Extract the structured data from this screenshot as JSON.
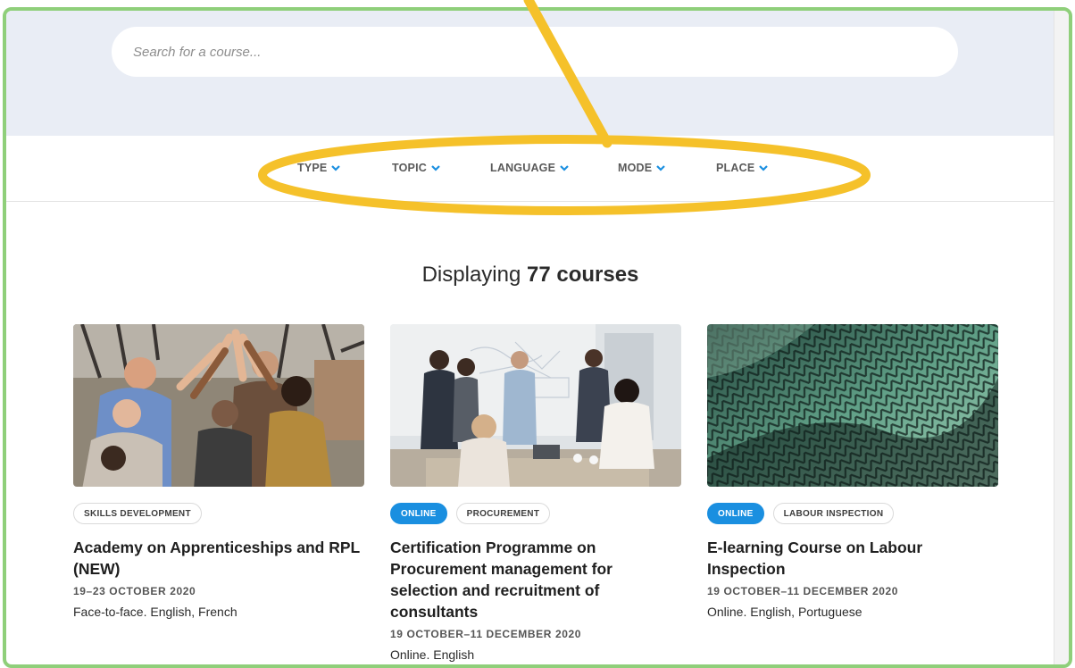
{
  "search": {
    "placeholder": "Search for a course..."
  },
  "filters": [
    {
      "label": "TYPE"
    },
    {
      "label": "TOPIC"
    },
    {
      "label": "LANGUAGE"
    },
    {
      "label": "MODE"
    },
    {
      "label": "PLACE"
    }
  ],
  "results": {
    "prefix": "Displaying ",
    "count": "77 courses"
  },
  "courses": [
    {
      "tags": [
        "SKILLS DEVELOPMENT"
      ],
      "title": "Academy on Apprenticeships and RPL (NEW)",
      "date": "19–23 OCTOBER 2020",
      "detail": "Face-to-face. English, French"
    },
    {
      "tags": [
        "ONLINE",
        "PROCUREMENT"
      ],
      "title": "Certification Programme on Procurement management for selection and recruitment of consultants",
      "date": "19 OCTOBER–11 DECEMBER 2020",
      "detail": "Online. English"
    },
    {
      "tags": [
        "ONLINE",
        "LABOUR INSPECTION"
      ],
      "title": "E-learning Course on Labour Inspection",
      "date": "19 OCTOBER–11 DECEMBER 2020",
      "detail": "Online. English, Portuguese"
    }
  ],
  "colors": {
    "frame_border": "#8fcf7a",
    "search_band": "#e9edf5",
    "accent_chevron": "#1a8fe0",
    "online_tag": "#1a8fe0",
    "annotation_highlight": "#f5c12a"
  },
  "icons": {
    "filter_chevron": "chevron-down-icon"
  }
}
